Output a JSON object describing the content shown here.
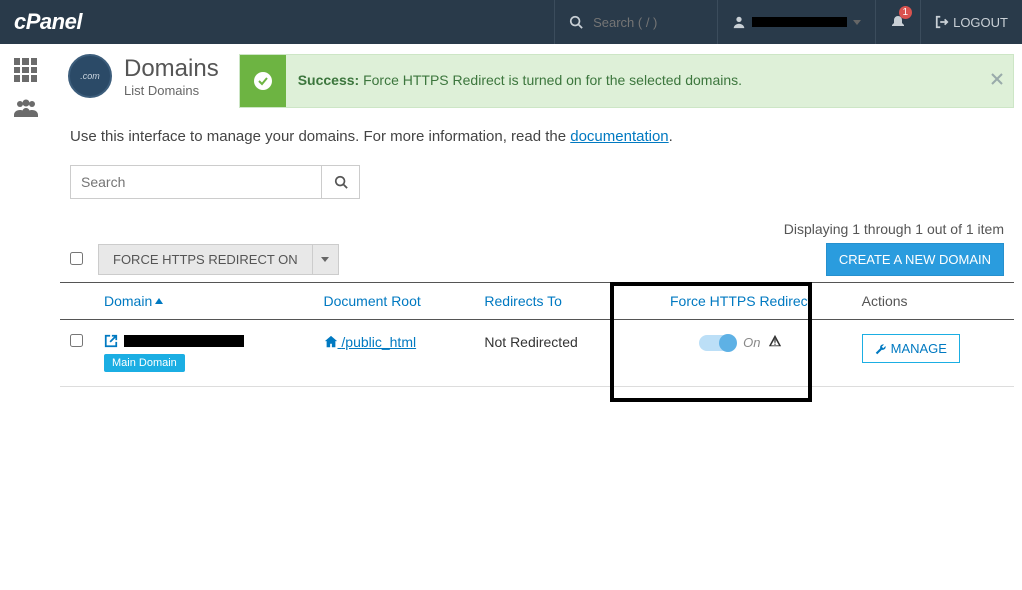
{
  "topbar": {
    "search_placeholder": "Search ( / )",
    "logout_label": "LOGOUT",
    "notification_count": "1"
  },
  "page": {
    "title": "Domains",
    "subtitle": "List Domains",
    "intro_prefix": "Use this interface to manage your domains. For more information, read the ",
    "intro_link": "documentation",
    "intro_suffix": "."
  },
  "alert": {
    "title": "Success:",
    "body": " Force HTTPS Redirect is turned on for the selected domains."
  },
  "search": {
    "placeholder": "Search"
  },
  "pagination_text": "Displaying 1 through 1 out of 1 item",
  "actions": {
    "force_https_btn": "FORCE HTTPS REDIRECT ON",
    "create_btn": "CREATE A NEW DOMAIN"
  },
  "columns": {
    "domain": "Domain",
    "docroot": "Document Root",
    "redirects": "Redirects To",
    "force_https": "Force HTTPS Redirect",
    "actions": "Actions"
  },
  "row": {
    "docroot": "/public_html",
    "redirects": "Not Redirected",
    "main_domain_badge": "Main Domain",
    "toggle_label": "On",
    "manage_label": "MANAGE"
  }
}
